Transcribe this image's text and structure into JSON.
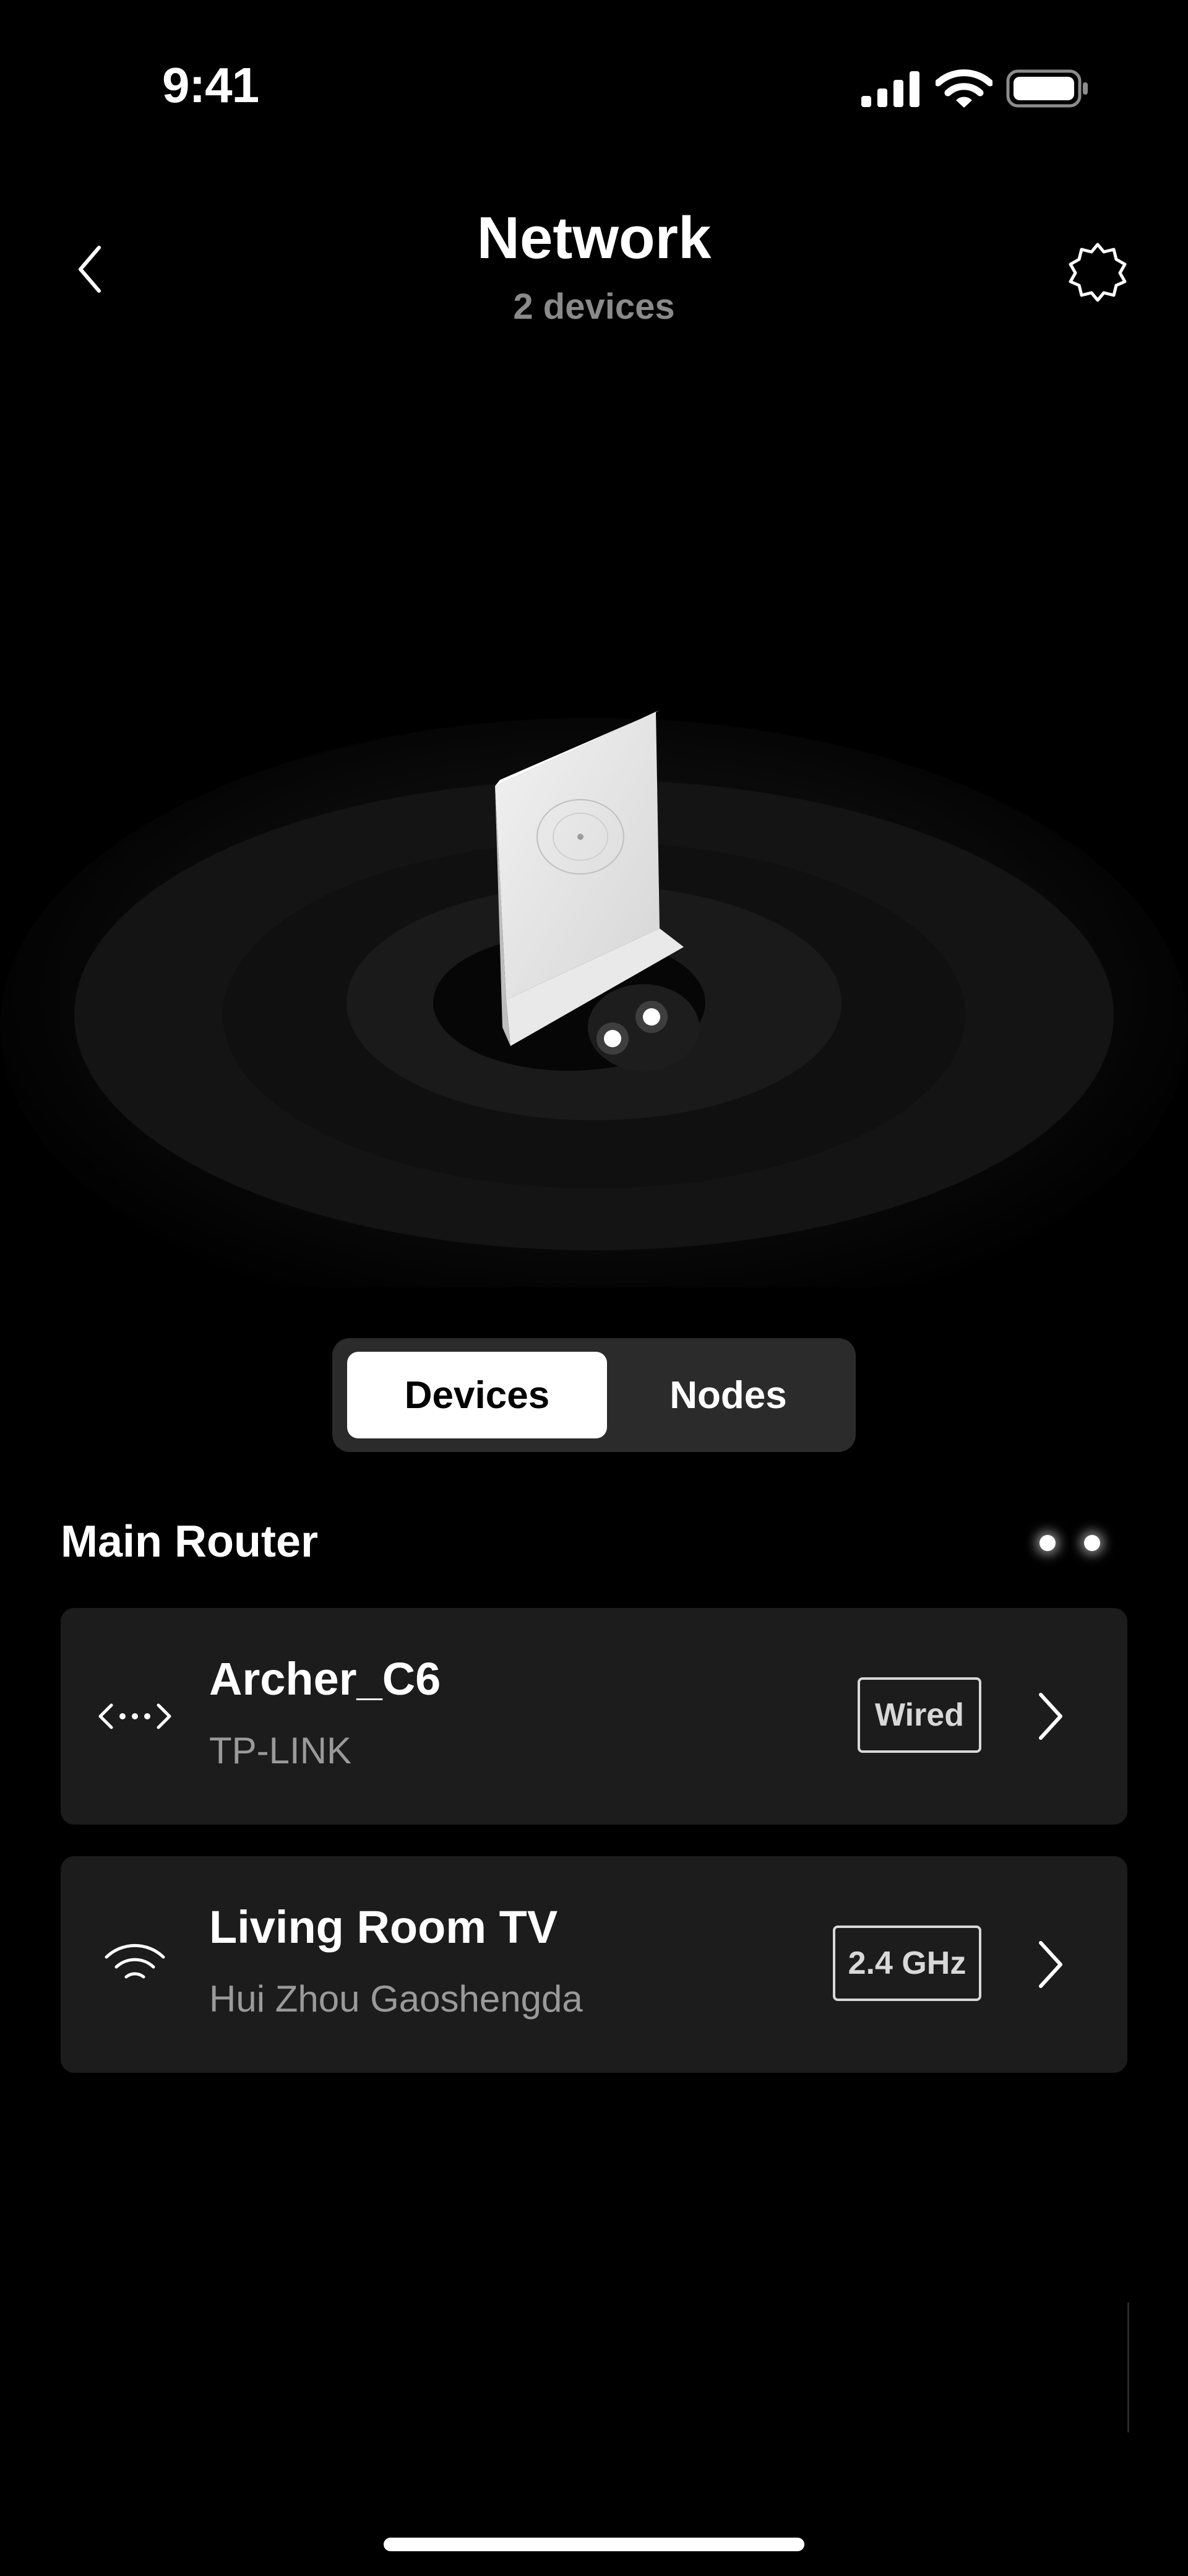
{
  "status_bar": {
    "time": "9:41",
    "icons": [
      "signal-icon",
      "wifi-icon",
      "battery-icon"
    ]
  },
  "header": {
    "title": "Network",
    "subtitle": "2 devices",
    "back_icon": "chevron-left-icon",
    "settings_icon": "gear-icon"
  },
  "segment": {
    "tabs": [
      {
        "label": "Devices",
        "active": true
      },
      {
        "label": "Nodes",
        "active": false
      }
    ]
  },
  "section": {
    "title": "Main Router",
    "indicator": "two-dots-icon"
  },
  "devices": [
    {
      "name": "Archer_C6",
      "vendor": "TP-LINK",
      "connection": "Wired",
      "icon": "ethernet-icon"
    },
    {
      "name": "Living Room TV",
      "vendor": "Hui Zhou Gaoshengda",
      "connection": "2.4 GHz",
      "icon": "wifi-icon"
    }
  ],
  "colors": {
    "background": "#000000",
    "card": "#1c1c1c",
    "segment_bg": "#2b2b2b",
    "muted_text": "#8a8a8a"
  }
}
